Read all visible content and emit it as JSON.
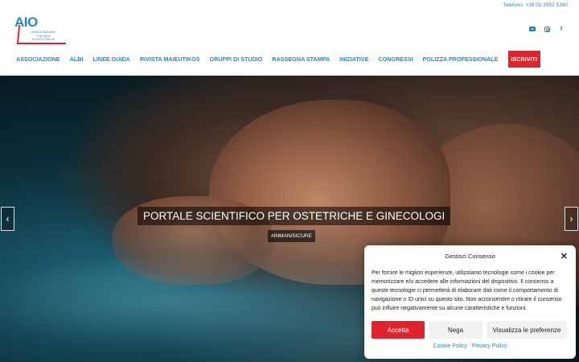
{
  "header": {
    "phone": "Telefono: +39 02 2952 5380",
    "logo_brand": "AIO",
    "logo_lines": [
      "ASSOCIAZIONE",
      "ITALIANA",
      "di OSTETRICIA"
    ],
    "social": [
      "youtube-icon",
      "instagram-icon",
      "facebook-icon"
    ]
  },
  "nav": {
    "items": [
      "ASSOCIAZIONE",
      "ALBI",
      "LINEE GUIDA",
      "RIVISTA MAIEUTIKOS",
      "GRUPPI DI STUDIO",
      "RASSEGNA STAMPA",
      "INIZIATIVE",
      "CONGRESSI",
      "POLIZZA PROFESSIONALE"
    ],
    "cta": "ISCRIVITI"
  },
  "hero": {
    "title": "PORTALE SCIENTIFICO PER OSTETRICHE E GINECOLOGI",
    "tag": "#INMANISICURE",
    "prev": "‹",
    "next": "›"
  },
  "consent": {
    "title": "Gestisci Consenso",
    "close": "✕",
    "body": "Per fornire le migliori esperienze, utilizziamo tecnologie come i cookie per memorizzare e/o accedere alle informazioni del dispositivo. Il consenso a queste tecnologie ci permetterà di elaborare dati come il comportamento di navigazione o ID unici su questo sito. Non acconsentire o ritirare il consenso può influire negativamente su alcune caratteristiche e funzioni.",
    "accept": "Accetta",
    "deny": "Nega",
    "preferences": "Visualizza le preferenze",
    "cookie_policy": "Cookie Policy",
    "privacy_policy": "Privacy Policy"
  },
  "colors": {
    "accent": "#1e88c8",
    "brand_red": "#e3232b"
  }
}
